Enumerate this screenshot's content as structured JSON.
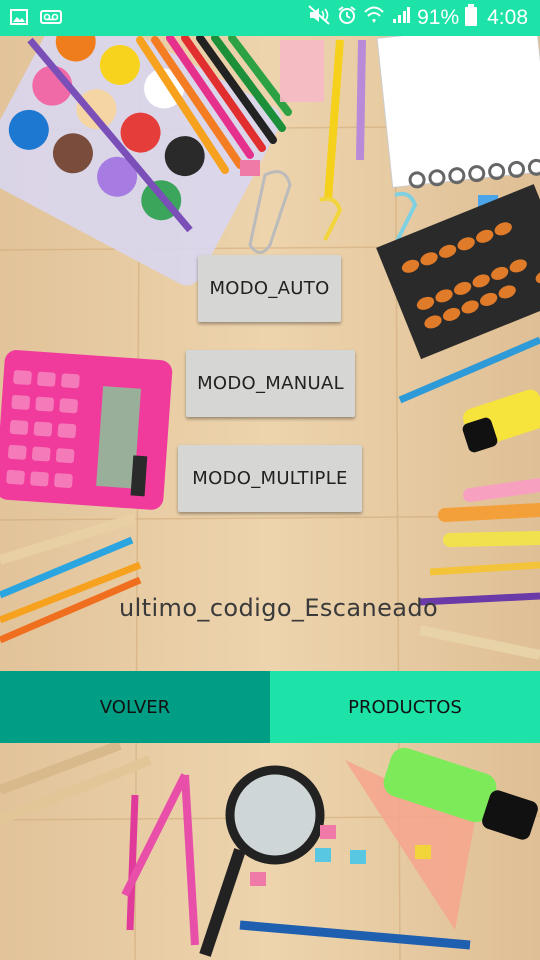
{
  "status_bar": {
    "battery_percent": "91%",
    "time": "4:08",
    "color": "#1ee3a8",
    "left_icons": [
      "image-icon",
      "voicemail-icon"
    ],
    "right_icons": [
      "mute-icon",
      "alarm-icon",
      "wifi-icon",
      "signal-icon",
      "battery-icon"
    ]
  },
  "modes": {
    "auto_label": "MODO_AUTO",
    "manual_label": "MODO_MANUAL",
    "multiple_label": "MODO_MULTIPLE"
  },
  "last_code": "ultimo_codigo_Escaneado",
  "bottom_bar": {
    "volver_label": "VOLVER",
    "productos_label": "PRODUCTOS",
    "volver_color": "#009e84",
    "productos_color": "#1ee3a8"
  }
}
